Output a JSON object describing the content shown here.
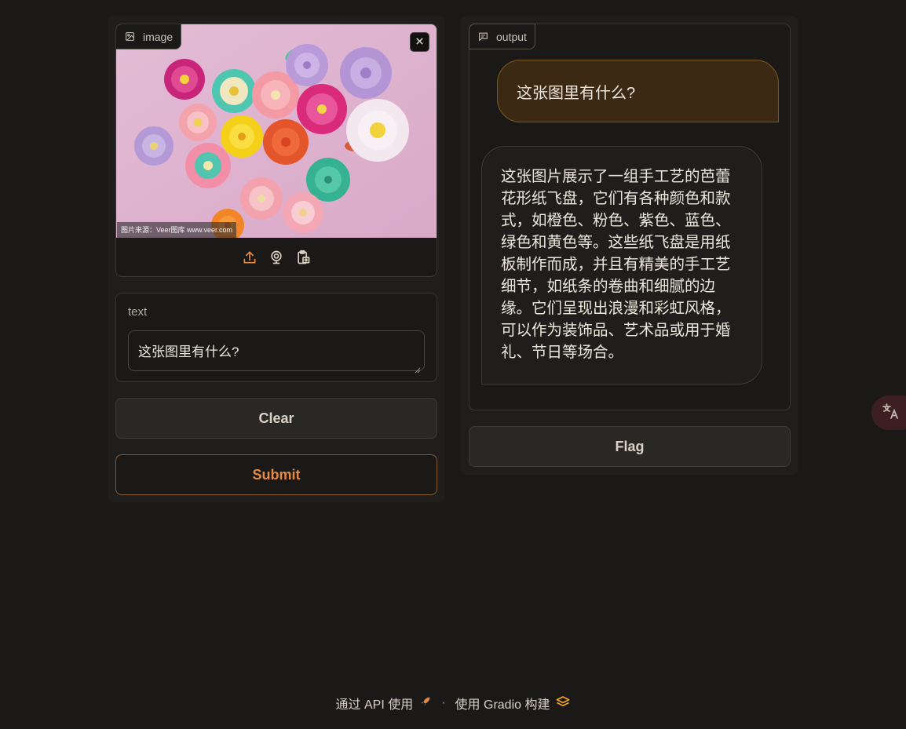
{
  "image_input": {
    "label": "image",
    "watermark": "图片来源：Veer图库 www.veer.com",
    "toolbar": [
      "upload-icon",
      "webcam-icon",
      "clipboard-icon"
    ]
  },
  "text_input": {
    "label": "text",
    "value": "这张图里有什么?"
  },
  "buttons": {
    "clear": "Clear",
    "submit": "Submit",
    "flag": "Flag"
  },
  "output": {
    "label": "output",
    "messages": [
      {
        "role": "user",
        "text": "这张图里有什么?"
      },
      {
        "role": "bot",
        "text": "这张图片展示了一组手工艺的芭蕾花形纸飞盘，它们有各种颜色和款式，如橙色、粉色、紫色、蓝色、绿色和黄色等。这些纸飞盘是用纸板制作而成，并且有精美的手工艺细节，如纸条的卷曲和细腻的边缘。它们呈现出浪漫和彩虹风格，可以作为装饰品、艺术品或用于婚礼、节日等场合。"
      }
    ]
  },
  "footer": {
    "api_link": "通过 API 使用",
    "separator": "·",
    "built_with": "使用 Gradio 构建"
  },
  "colors": {
    "background": "#1b1917",
    "accent": "#e58a45",
    "user_bubble": "#3b2914",
    "bot_bubble": "#201e1c"
  }
}
